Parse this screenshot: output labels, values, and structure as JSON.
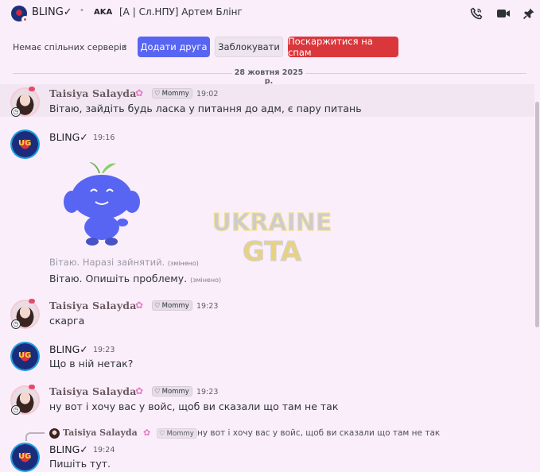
{
  "header": {
    "username": "BLING✓",
    "aka_label": "AKA",
    "aka_text": "[A | Сл.НПУ] Артем Блінг",
    "icons": [
      "phone-icon",
      "video-icon",
      "pin-icon"
    ]
  },
  "intro": {
    "no_servers": "Немає спільних серверів",
    "add_friend": "Додати друга",
    "block": "Заблокувати",
    "report_spam": "Поскаржитися на спам"
  },
  "date_divider": "28 жовтня 2025 р.",
  "messages": [
    {
      "author": "Taisiya Salayda",
      "tag": "Mommy",
      "time": "19:02",
      "lines": [
        "Вітаю, зайдіть будь ласка у питання до адм, є пару питань"
      ]
    },
    {
      "author": "BLING✓",
      "time": "19:16",
      "lines": [
        "Вітаю. Наразі зайнятий.",
        "Вітаю. Опишіть проблему."
      ],
      "edited": "(змінено)"
    },
    {
      "author": "Taisiya Salayda",
      "tag": "Mommy",
      "time": "19:23",
      "lines": [
        "скарга"
      ]
    },
    {
      "author": "BLING✓",
      "time": "19:23",
      "lines": [
        "Що в ній нетак?"
      ]
    },
    {
      "author": "Taisiya Salayda",
      "tag": "Mommy",
      "time": "19:23",
      "lines": [
        "ну вот і хочу вас у войс, щоб ви сказали що там не так"
      ]
    },
    {
      "author": "BLING✓",
      "time": "19:24",
      "lines": [
        "Пишіть тут."
      ]
    }
  ],
  "reply": {
    "author": "Taisiya Salayda",
    "tag": "Mommy",
    "text": "ну вот і хочу вас у войс, щоб ви сказали що там не так"
  },
  "watermark": {
    "line1": "UKRAINE",
    "line2": "GTA"
  },
  "colors": {
    "accent": "#5865f2",
    "danger": "#da373c",
    "background": "#fbeefb"
  }
}
